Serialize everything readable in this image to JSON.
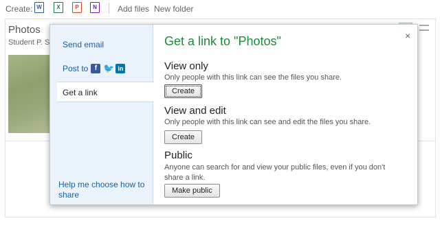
{
  "toolbar": {
    "create_label": "Create:",
    "doc_icons": [
      "W",
      "X",
      "P",
      "N"
    ],
    "add_files": "Add files",
    "new_folder": "New folder"
  },
  "background": {
    "folder_title": "Photos",
    "owner": "Student P. Se"
  },
  "dialog": {
    "title": "Get a link to \"Photos\"",
    "close_glyph": "×",
    "sidebar": {
      "send_email": "Send email",
      "post_to": "Post to",
      "get_a_link": "Get a link",
      "help": "Help me choose how to share"
    },
    "sections": {
      "view_only": {
        "heading": "View only",
        "description": "Only people with this link can see the files you share.",
        "button": "Create"
      },
      "view_edit": {
        "heading": "View and edit",
        "description": "Only people with this link can see and edit the files you share.",
        "button": "Create"
      },
      "public": {
        "heading": "Public",
        "description": "Anyone can search for and view your public files, even if you don't share a link.",
        "button": "Make public"
      }
    }
  },
  "colors": {
    "title_green": "#1d8a3b",
    "link_blue": "#1a5fa6",
    "sidebar_bg": "#eaf3fb"
  },
  "icons": {
    "facebook": "facebook-icon",
    "twitter": "twitter-icon",
    "linkedin": "linkedin-icon",
    "close": "close-icon"
  }
}
